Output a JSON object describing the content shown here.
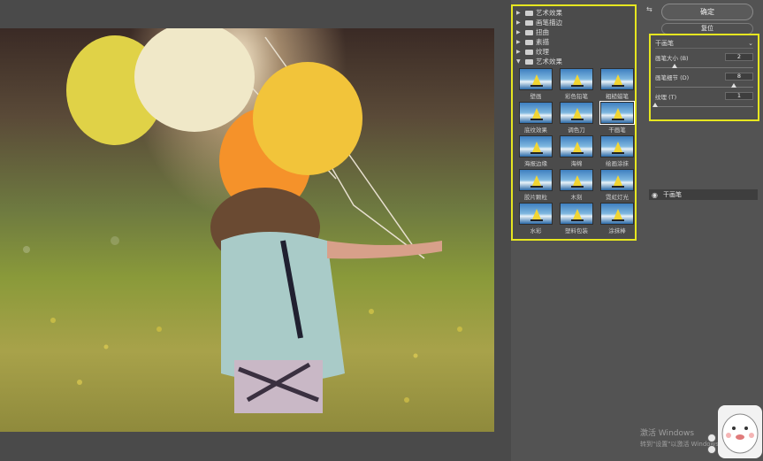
{
  "effects": {
    "folders": [
      {
        "label": "艺术效果",
        "expanded": false
      },
      {
        "label": "画笔描边",
        "expanded": false
      },
      {
        "label": "扭曲",
        "expanded": false
      },
      {
        "label": "素描",
        "expanded": false
      },
      {
        "label": "纹理",
        "expanded": false
      },
      {
        "label": "艺术效果",
        "expanded": true
      }
    ],
    "thumbnails": [
      {
        "label": "壁画",
        "selected": false
      },
      {
        "label": "彩色铅笔",
        "selected": false
      },
      {
        "label": "粗糙蜡笔",
        "selected": false
      },
      {
        "label": "底纹效果",
        "selected": false
      },
      {
        "label": "调色刀",
        "selected": false
      },
      {
        "label": "干画笔",
        "selected": true
      },
      {
        "label": "海报边缘",
        "selected": false
      },
      {
        "label": "海绵",
        "selected": false
      },
      {
        "label": "绘画涂抹",
        "selected": false
      },
      {
        "label": "胶片颗粒",
        "selected": false
      },
      {
        "label": "木刻",
        "selected": false
      },
      {
        "label": "霓虹灯光",
        "selected": false
      },
      {
        "label": "水彩",
        "selected": false
      },
      {
        "label": "塑料包装",
        "selected": false
      },
      {
        "label": "涂抹棒",
        "selected": false
      }
    ]
  },
  "buttons": {
    "ok_label": "确定",
    "reset_label": "复位",
    "panel_toggle": "⇆"
  },
  "settings": {
    "filter_name": "干画笔",
    "params": [
      {
        "label": "画笔大小 (B)",
        "value": "2",
        "fraction": 0.2
      },
      {
        "label": "画笔细节 (D)",
        "value": "8",
        "fraction": 0.8
      },
      {
        "label": "纹理 (T)",
        "value": "1",
        "fraction": 0.0
      }
    ]
  },
  "layers": {
    "name": "干画笔"
  },
  "watermark": {
    "line1": "激活 Windows",
    "line2": "转到\"设置\"以激活 Windows。"
  },
  "colors": {
    "highlight": "#e6e620",
    "panel_bg": "#535353"
  }
}
